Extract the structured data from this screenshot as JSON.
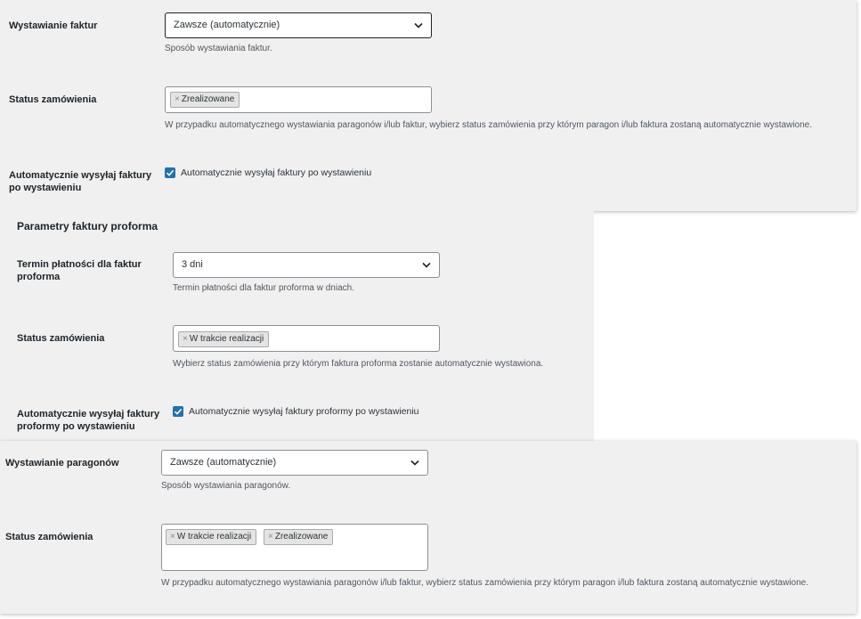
{
  "invoices": {
    "issuing_label": "Wystawianie faktur",
    "issuing_value": "Zawsze (automatycznie)",
    "issuing_desc": "Sposób wystawiania faktur.",
    "status_label": "Status zamówienia",
    "status_chips": [
      "Zrealizowane"
    ],
    "status_desc": "W przypadku automatycznego wystawiania paragonów i/lub faktur, wybierz status zamówienia przy którym paragon i/lub faktura zostaną automatycznie wystawione.",
    "autosend_label_line1": "Automatycznie wysyłaj faktury",
    "autosend_label_line2": "po wystawieniu",
    "autosend_checkbox_label": "Automatycznie wysyłaj faktury po wystawieniu"
  },
  "proforma": {
    "section_title": "Parametry faktury proforma",
    "term_label_line1": "Termin płatności dla faktur",
    "term_label_line2": "proforma",
    "term_value": "3 dni",
    "term_desc": "Termin płatności dla faktur proforma w dniach.",
    "status_label": "Status zamówienia",
    "status_chips": [
      "W trakcie realizacji"
    ],
    "status_desc": "Wybierz status zamówienia przy którym faktura proforma zostanie automatycznie wystawiona.",
    "autosend_label_line1": "Automatycznie wysyłaj faktury",
    "autosend_label_line2": "proformy po wystawieniu",
    "autosend_checkbox_label": "Automatycznie wysyłaj faktury proformy po wystawieniu"
  },
  "receipts": {
    "issuing_label": "Wystawianie paragonów",
    "issuing_value": "Zawsze (automatycznie)",
    "issuing_desc": "Sposób wystawiania paragonów.",
    "status_label": "Status zamówienia",
    "status_chips": [
      "W trakcie realizacji",
      "Zrealizowane"
    ],
    "status_desc": "W przypadku automatycznego wystawiania paragonów i/lub faktur, wybierz status zamówienia przy którym paragon i/lub faktura zostaną automatycznie wystawione."
  },
  "icons": {
    "chevron": "chevron-down-icon",
    "remove": "remove-icon",
    "check": "checkmark-icon"
  },
  "colors": {
    "checkbox": "#2271b1",
    "panel": "#f0f0f1"
  }
}
